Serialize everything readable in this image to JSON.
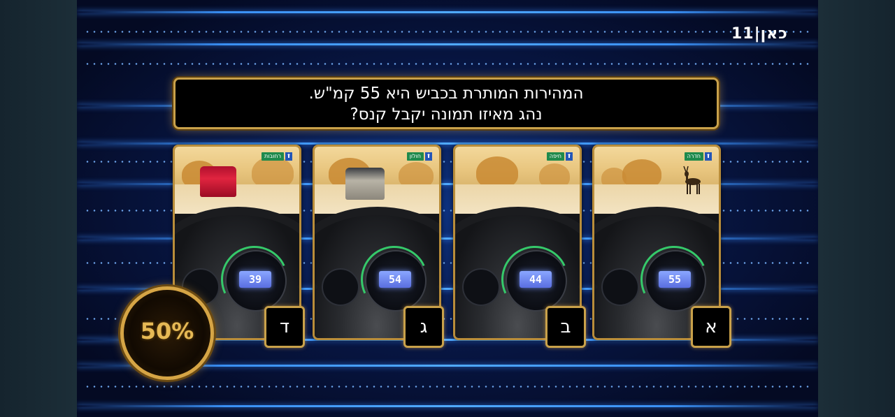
{
  "channel_logo": "כאן|11",
  "question": {
    "line1": "המהירות המותרת בכביש היא 55 קמ\"ש.",
    "line2": "נהג מאיזו תמונה יקבל קנס?"
  },
  "answers": [
    {
      "letter": "ד",
      "sign": "רחובות",
      "speed": "39",
      "scene": "red-car"
    },
    {
      "letter": "ג",
      "sign": "חולון",
      "speed": "54",
      "scene": "silver-suv"
    },
    {
      "letter": "ב",
      "sign": "חיפה",
      "speed": "44",
      "scene": "empty-road"
    },
    {
      "letter": "א",
      "sign": "חדרה",
      "speed": "55",
      "scene": "deer"
    }
  ],
  "lifeline": {
    "label": "50%"
  },
  "colors": {
    "gold": "#c9a14a",
    "blue_line": "#3c96ff",
    "sign_green": "#1f8a4c",
    "lcd": "#6f86f0"
  }
}
